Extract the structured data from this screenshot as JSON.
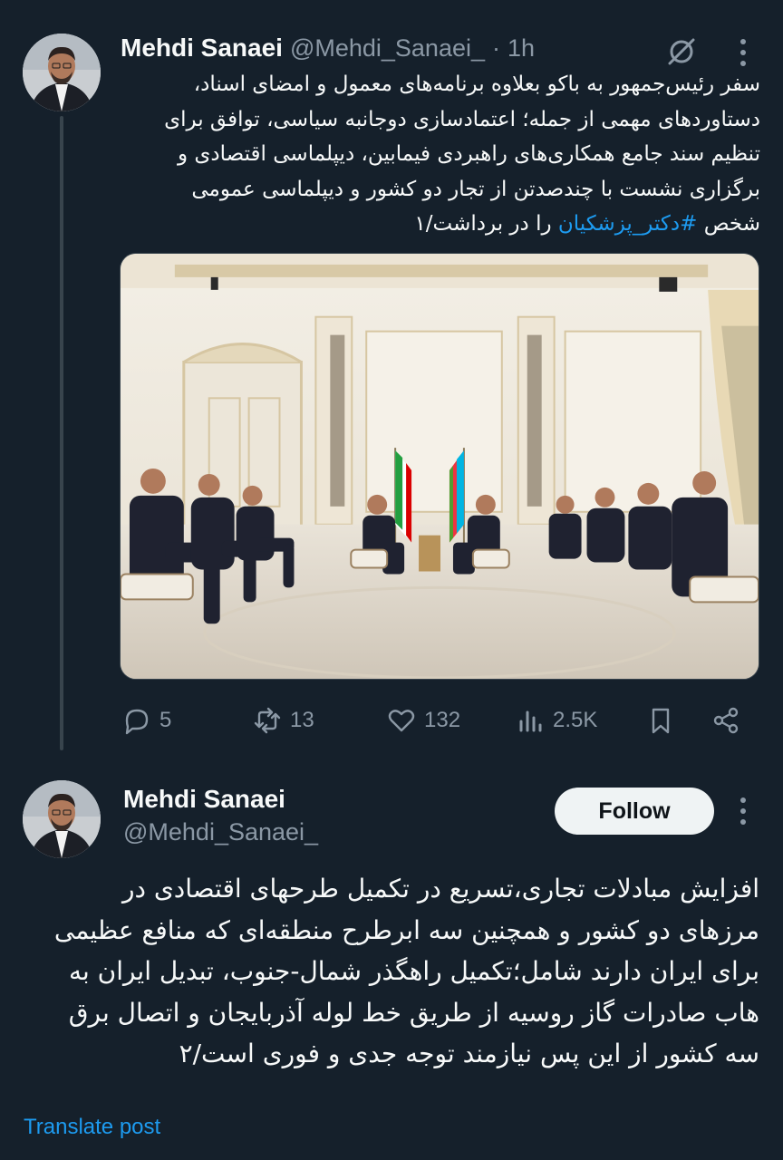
{
  "tweet1": {
    "author_name": "Mehdi Sanaei",
    "handle": "@Mehdi_Sanaei_",
    "separator": "·",
    "time": "1h",
    "text_lines": [
      "سفر رئیس‌جمهور به باکو بعلاوه برنامه‌های معمول و امضای اسناد،",
      "دستاوردهای مهمی از جمله؛ اعتمادسازی دوجانبه سیاسی، توافق برای",
      "تنظیم سند جامع همکاری‌های راهبردی فیمابین، دیپلماسی اقتصادی و",
      "برگزاری نشست با چندصدتن از تجار دو کشور و دیپلماسی عمومی"
    ],
    "last_line_before": "شخص ",
    "hashtag": "#دکتر_پزشکیان",
    "last_line_after": " را در برداشت/۱",
    "image_icon": "meeting-photo",
    "actions": {
      "replies": "5",
      "reposts": "13",
      "likes": "132",
      "views": "2.5K"
    }
  },
  "tweet2": {
    "author_name": "Mehdi Sanaei",
    "handle": "@Mehdi_Sanaei_",
    "follow_label": "Follow",
    "text_lines": [
      "افزایش مبادلات تجاری،تسریع در تکمیل طرحهای اقتصادی در",
      "مرزهای دو کشور و همچنین سه ابرطرح منطقه‌ای که منافع عظیمی",
      "برای ایران دارند شامل؛تکمیل راهگذر شمال-جنوب، تبدیل ایران به",
      "هاب صادرات گاز روسیه از طریق خط لوله آذربایجان و اتصال برق",
      "سه کشور از این پس نیازمند توجه جدی و فوری است/۲"
    ],
    "translate_label": "Translate post"
  },
  "colors": {
    "background": "#15202b",
    "text": "#f7f9f9",
    "muted": "#8b98a5",
    "link": "#1d9bf0",
    "thread_line": "#38444d"
  }
}
